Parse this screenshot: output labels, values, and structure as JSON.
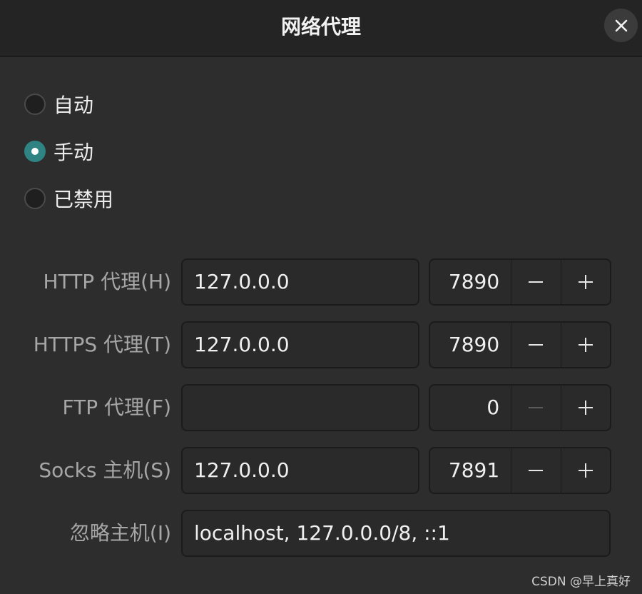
{
  "window": {
    "title": "网络代理",
    "close_icon": "close-icon"
  },
  "modes": [
    {
      "label": "自动",
      "checked": false
    },
    {
      "label": "手动",
      "checked": true
    },
    {
      "label": "已禁用",
      "checked": false
    }
  ],
  "proxies": {
    "http": {
      "label": "HTTP 代理(H)",
      "host": "127.0.0.0",
      "port": "7890",
      "minus_enabled": true
    },
    "https": {
      "label": "HTTPS 代理(T)",
      "host": "127.0.0.0",
      "port": "7890",
      "minus_enabled": true
    },
    "ftp": {
      "label": "FTP 代理(F)",
      "host": "",
      "port": "0",
      "minus_enabled": false
    },
    "socks": {
      "label": "Socks 主机(S)",
      "host": "127.0.0.0",
      "port": "7891",
      "minus_enabled": true
    }
  },
  "ignore_hosts": {
    "label": "忽略主机(I)",
    "value": "localhost, 127.0.0.0/8, ::1"
  },
  "watermark": "CSDN @早上真好",
  "colors": {
    "accent": "#2f8383",
    "background": "#2d2d2d",
    "titlebar": "#242424"
  }
}
